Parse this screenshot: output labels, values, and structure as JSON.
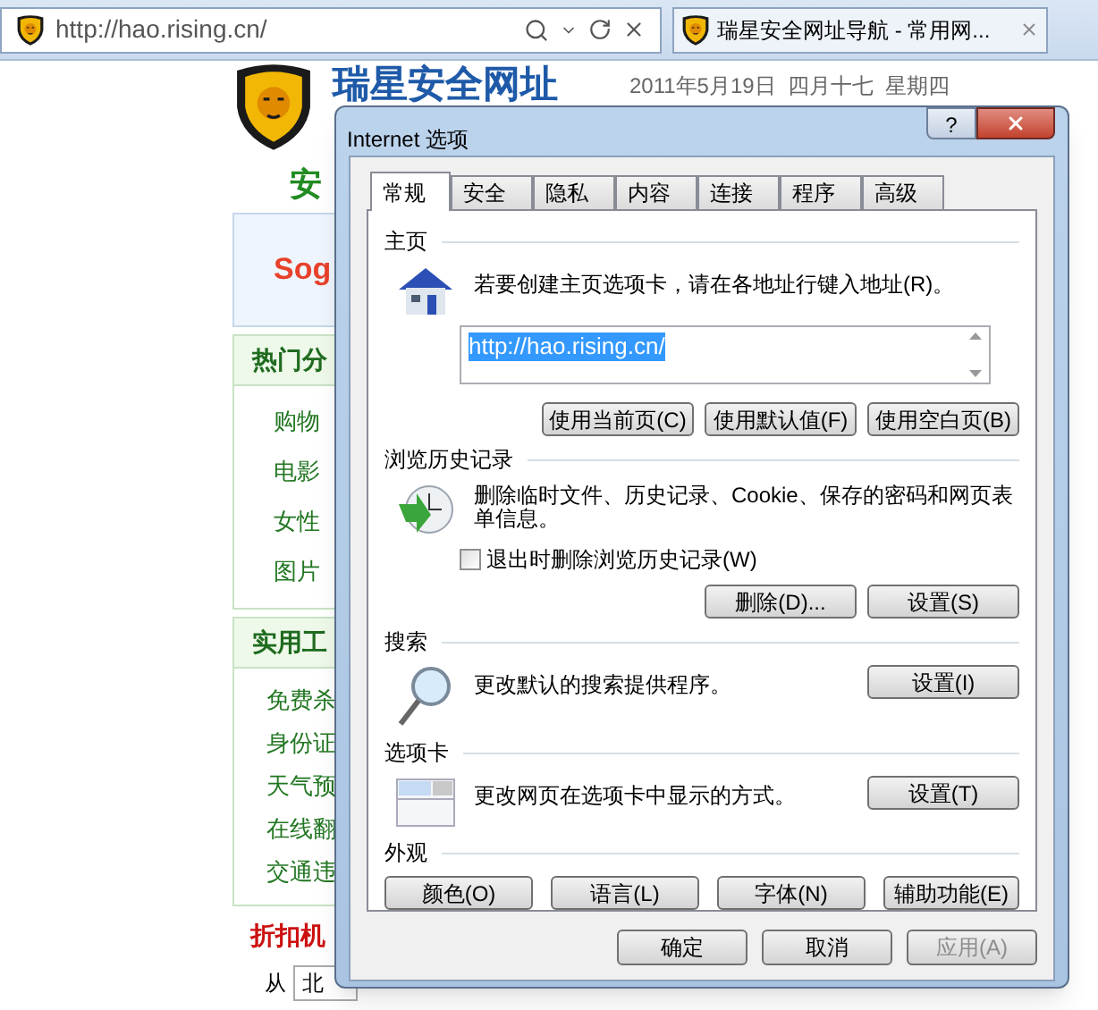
{
  "browser": {
    "address": "http://hao.rising.cn/",
    "tab_title": "瑞星安全网址导航 - 常用网..."
  },
  "page": {
    "site_title": "瑞星安全网址",
    "date": "2011年5月19日  四月十七  星期四",
    "heading": "安",
    "search_logo": "Sog",
    "sections": [
      {
        "title": "热门分",
        "items": [
          "购物",
          "电影",
          "女性",
          "图片"
        ]
      },
      {
        "title": "实用工",
        "items": [
          "免费杀",
          "身份证",
          "天气预",
          "在线翻",
          "交通违"
        ]
      }
    ],
    "deals_title": "折扣机",
    "from_label": "从",
    "from_value": "北"
  },
  "dialog": {
    "title": "Internet 选项",
    "help": "?",
    "tabs": [
      {
        "label": "常规",
        "selected": true
      },
      {
        "label": "安全",
        "selected": false
      },
      {
        "label": "隐私",
        "selected": false
      },
      {
        "label": "内容",
        "selected": false
      },
      {
        "label": "连接",
        "selected": false
      },
      {
        "label": "程序",
        "selected": false
      },
      {
        "label": "高级",
        "selected": false
      }
    ],
    "home": {
      "title": "主页",
      "text": "若要创建主页选项卡，请在各地址行键入地址(R)。",
      "url": "http://hao.rising.cn/",
      "buttons": [
        "使用当前页(C)",
        "使用默认值(F)",
        "使用空白页(B)"
      ]
    },
    "history": {
      "title": "浏览历史记录",
      "text": "删除临时文件、历史记录、Cookie、保存的密码和网页表单信息。",
      "checkbox": {
        "label": "退出时删除浏览历史记录(W)",
        "checked": false
      },
      "buttons": [
        "删除(D)...",
        "设置(S)"
      ]
    },
    "search": {
      "title": "搜索",
      "text": "更改默认的搜索提供程序。",
      "button": "设置(I)"
    },
    "tabs_section": {
      "title": "选项卡",
      "text": "更改网页在选项卡中显示的方式。",
      "button": "设置(T)"
    },
    "appearance": {
      "title": "外观",
      "buttons": [
        "颜色(O)",
        "语言(L)",
        "字体(N)",
        "辅助功能(E)"
      ]
    },
    "footer": [
      {
        "label": "确定",
        "kind": "default"
      },
      {
        "label": "取消",
        "kind": "normal"
      },
      {
        "label": "应用(A)",
        "kind": "disabled"
      }
    ]
  }
}
